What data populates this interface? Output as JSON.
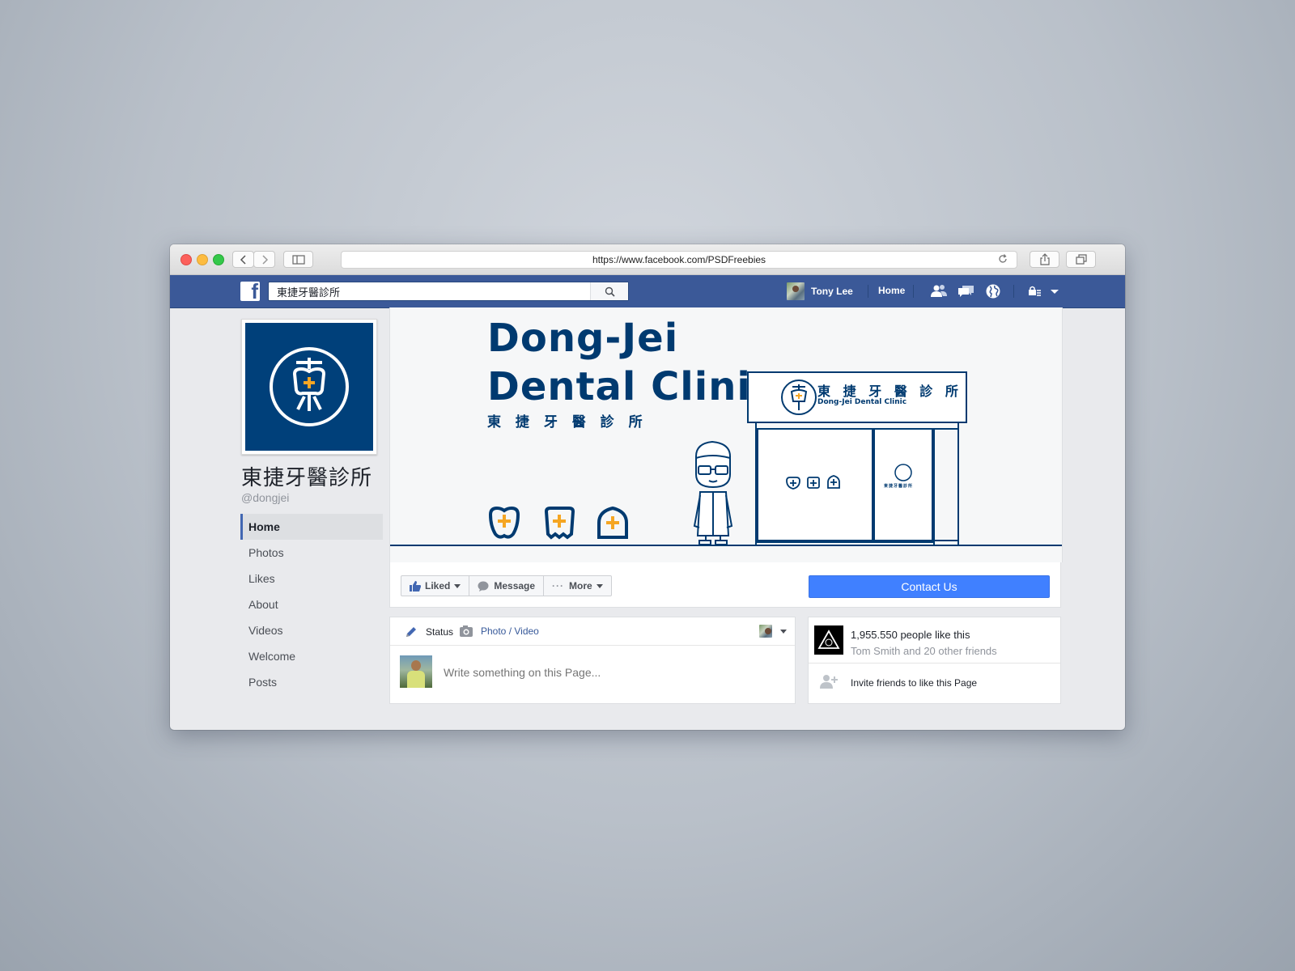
{
  "browser": {
    "url": "https://www.facebook.com/PSDFreebies"
  },
  "fb": {
    "search_value": "東捷牙醫診所",
    "user_name": "Tony Lee",
    "home_label": "Home"
  },
  "page": {
    "name": "東捷牙醫診所",
    "handle": "@dongjei",
    "nav": [
      "Home",
      "Photos",
      "Likes",
      "About",
      "Videos",
      "Welcome",
      "Posts"
    ],
    "active_nav": "Home"
  },
  "cover": {
    "title_line1": "Dong-Jei",
    "title_line2": "Dental Clinic",
    "subtitle": "東 捷 牙 醫 診 所",
    "sign_cn": "東 捷 牙 醫 診 所",
    "sign_en": "Dong-Jei Dental Clinic",
    "door_cn": "東捷牙醫診所"
  },
  "actions": {
    "liked": "Liked",
    "message": "Message",
    "more": "More",
    "contact": "Contact Us"
  },
  "composer": {
    "status_label": "Status",
    "photo_video_label": "Photo / Video",
    "placeholder": "Write something on this Page..."
  },
  "likes_box": {
    "count_text": "1,955.550 people like this",
    "friends_text": "Tom Smith and 20 other friends",
    "invite_text": "Invite friends to like this Page"
  },
  "colors": {
    "fb_blue": "#3b5998",
    "brand_navy": "#003a70",
    "accent_orange": "#f5a623",
    "contact_blue": "#4080ff"
  }
}
